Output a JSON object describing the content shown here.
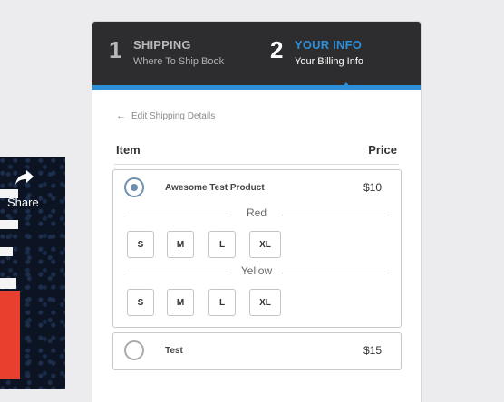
{
  "share": {
    "label": "Share"
  },
  "steps": [
    {
      "number": "1",
      "title": "SHIPPING",
      "subtitle": "Where To Ship Book"
    },
    {
      "number": "2",
      "title": "YOUR INFO",
      "subtitle": "Your Billing Info"
    }
  ],
  "back_link": "Edit Shipping Details",
  "columns": {
    "item": "Item",
    "price": "Price"
  },
  "products": [
    {
      "name": "Awesome Test Product",
      "price": "$10",
      "selected": true,
      "colors": [
        {
          "name": "Red",
          "sizes": [
            "S",
            "M",
            "L",
            "XL"
          ]
        },
        {
          "name": "Yellow",
          "sizes": [
            "S",
            "M",
            "L",
            "XL"
          ]
        }
      ]
    },
    {
      "name": "Test",
      "price": "$15",
      "selected": false
    }
  ],
  "colors": {
    "accent": "#2d8fd8",
    "header_bg": "#2d2d2f",
    "share_red": "#e8402e"
  },
  "icons": {
    "share": "share-arrow-icon",
    "back": "arrow-left-icon"
  }
}
